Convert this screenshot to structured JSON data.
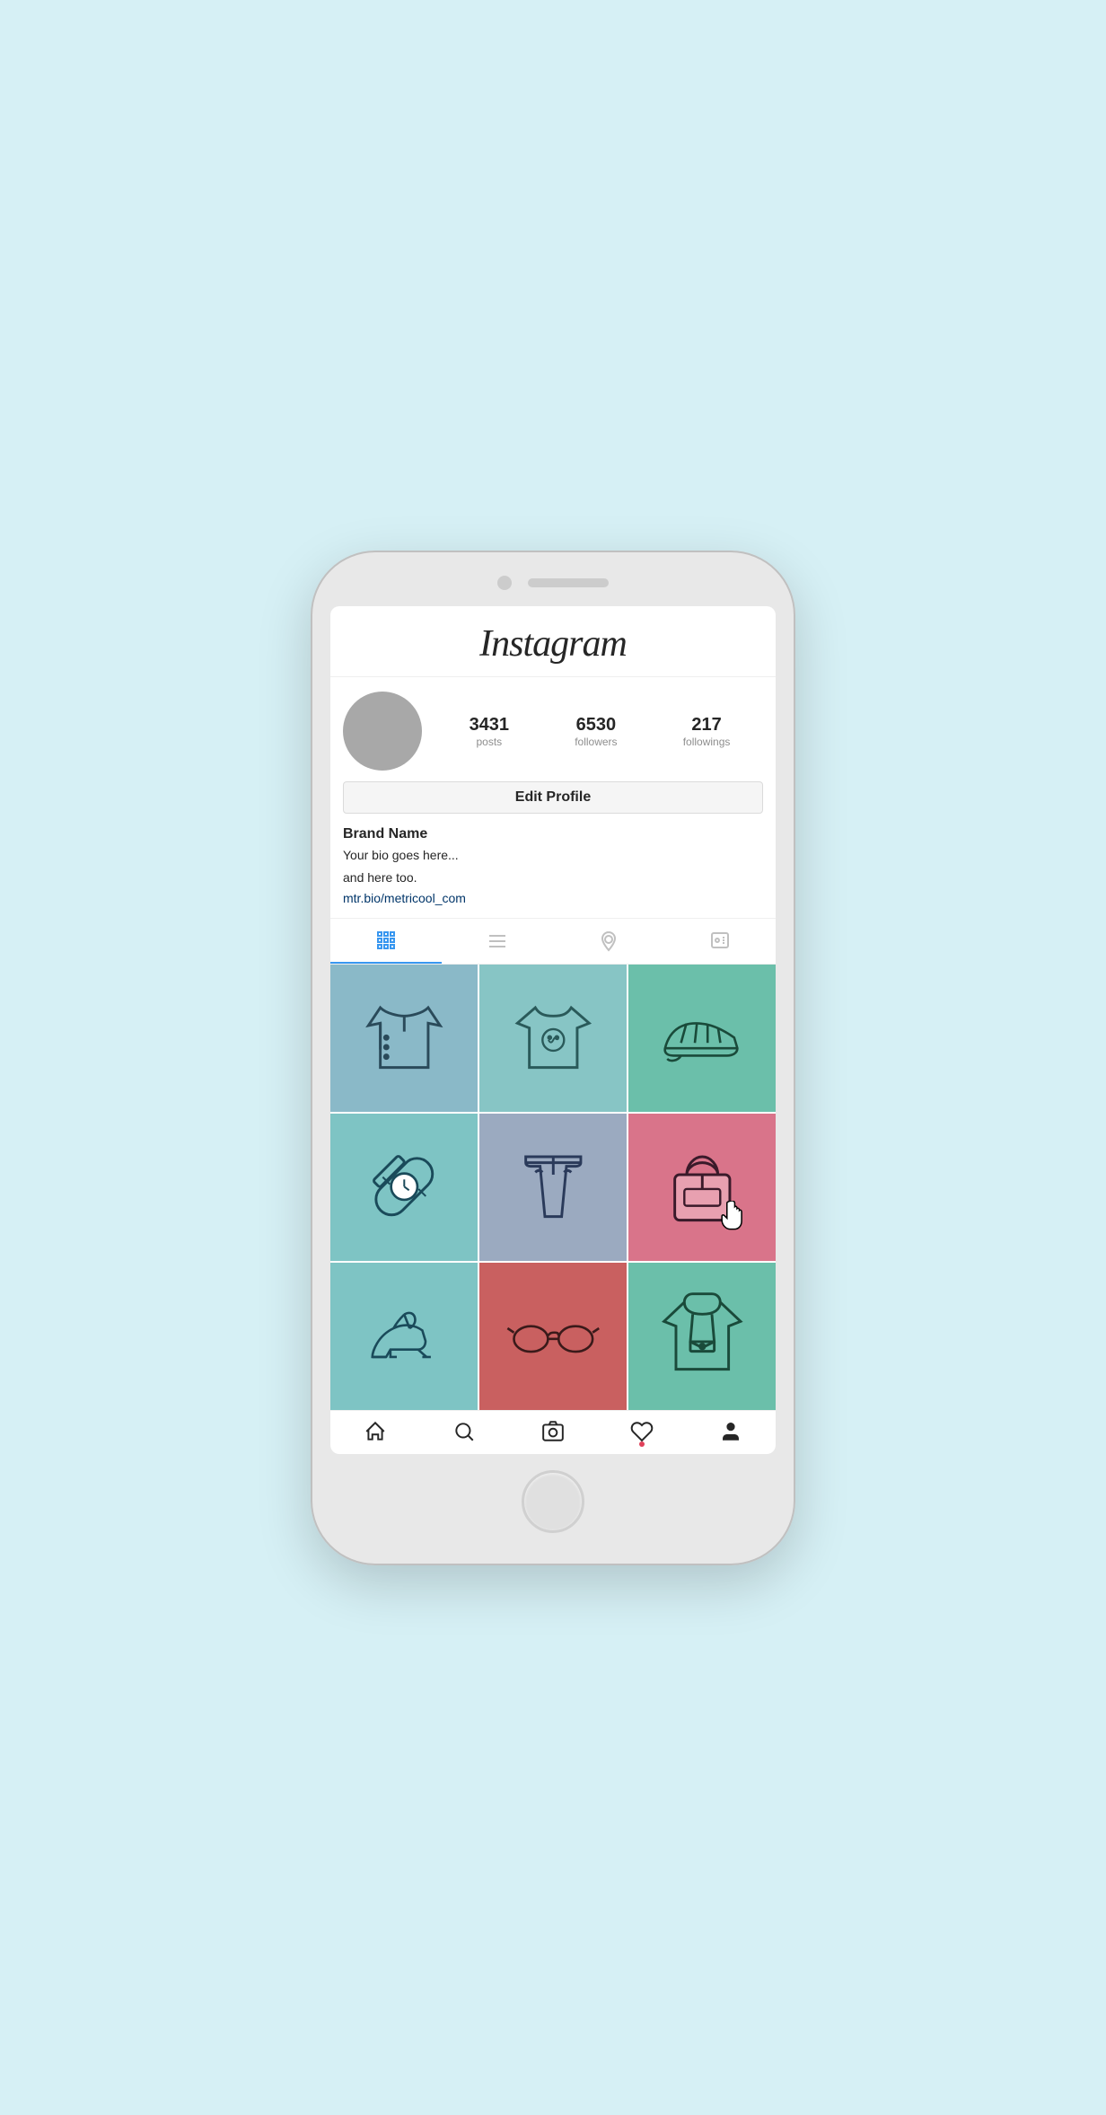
{
  "header": {
    "logo": "Instagram"
  },
  "profile": {
    "stats": {
      "posts_count": "3431",
      "posts_label": "posts",
      "followers_count": "6530",
      "followers_label": "followers",
      "followings_count": "217",
      "followings_label": "followings"
    },
    "edit_button_label": "Edit Profile",
    "bio": {
      "name": "Brand Name",
      "text_line1": "Your bio goes here...",
      "text_line2": "and here too.",
      "link": "mtr.bio/metricool_com"
    }
  },
  "tabs": [
    {
      "id": "grid",
      "label": "Grid",
      "active": true
    },
    {
      "id": "list",
      "label": "List",
      "active": false
    },
    {
      "id": "location",
      "label": "Location",
      "active": false
    },
    {
      "id": "tagged",
      "label": "Tagged",
      "active": false
    }
  ],
  "grid": {
    "items": [
      {
        "id": 1,
        "color_class": "grid-color-1",
        "type": "jacket"
      },
      {
        "id": 2,
        "color_class": "grid-color-2",
        "type": "tshirt"
      },
      {
        "id": 3,
        "color_class": "grid-color-3",
        "type": "shoe"
      },
      {
        "id": 4,
        "color_class": "grid-color-4",
        "type": "watch"
      },
      {
        "id": 5,
        "color_class": "grid-color-5",
        "type": "pants"
      },
      {
        "id": 6,
        "color_class": "grid-color-6",
        "type": "bag",
        "has_cursor": true
      },
      {
        "id": 7,
        "color_class": "grid-color-7",
        "type": "heels"
      },
      {
        "id": 8,
        "color_class": "grid-color-8",
        "type": "sunglasses"
      },
      {
        "id": 9,
        "color_class": "grid-color-9",
        "type": "hoodie"
      }
    ]
  },
  "bottom_nav": [
    {
      "id": "home",
      "label": "Home"
    },
    {
      "id": "search",
      "label": "Search"
    },
    {
      "id": "camera",
      "label": "Camera"
    },
    {
      "id": "heart",
      "label": "Activity"
    },
    {
      "id": "profile",
      "label": "Profile"
    }
  ]
}
